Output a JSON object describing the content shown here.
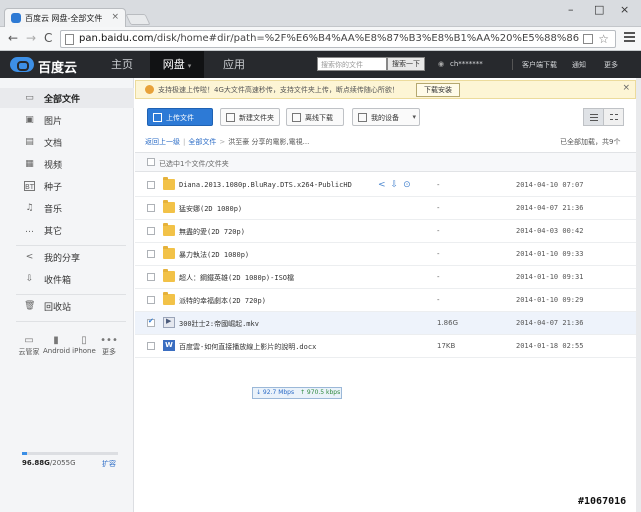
{
  "browser": {
    "tab_title": "百度云 网盘-全部文件",
    "tab_close": "×",
    "url_host": "pan.baidu.com",
    "url_path": "/disk/home#dir/path=%2F%E6%B4%AA%E8%87%B3%E8%B1%AA%20%E5%88%86%E4%BA%AB",
    "win_min": "–",
    "win_max": "□",
    "win_close": "×",
    "back": "←",
    "forward": "→",
    "reload": "C",
    "star": "☆"
  },
  "header": {
    "logo_text": "百度云",
    "nav": [
      {
        "label": "主页"
      },
      {
        "label": "网盘"
      },
      {
        "label": "应用"
      }
    ],
    "search_placeholder": "搜索你的文件",
    "search_button": "搜索一下",
    "user": "ch*******",
    "links": [
      "客户端下载",
      "通知",
      "更多"
    ]
  },
  "sidebar": {
    "items": [
      {
        "label": "全部文件",
        "icon": "▭"
      },
      {
        "label": "图片",
        "icon": "▣"
      },
      {
        "label": "文档",
        "icon": "▤"
      },
      {
        "label": "视频",
        "icon": "▦"
      },
      {
        "label": "种子",
        "icon": "BT"
      },
      {
        "label": "音乐",
        "icon": "♫"
      },
      {
        "label": "其它",
        "icon": "…"
      },
      {
        "label": "我的分享",
        "icon": "<"
      },
      {
        "label": "收件箱",
        "icon": "⇩"
      },
      {
        "label": "回收站",
        "icon": "🗑"
      }
    ],
    "devices": [
      {
        "label": "云管家",
        "icon": "▭"
      },
      {
        "label": "Android",
        "icon": "▮"
      },
      {
        "label": "iPhone",
        "icon": "▯"
      },
      {
        "label": "更多",
        "icon": "•••"
      }
    ],
    "quota_used": "96.88G",
    "quota_total": "/2055G",
    "quota_fraction": 0.047,
    "expand_label": "扩容"
  },
  "notice": {
    "text": "支持极速上传啦！4G大文件高速秒传，支持文件夹上传，断点续传随心所欲！",
    "button": "下载安装",
    "close": "×"
  },
  "toolbar": {
    "upload": "上传文件",
    "new_folder": "新建文件夹",
    "offline": "离线下载",
    "devices": "我的设备"
  },
  "breadcrumb": {
    "back": "返回上一级",
    "all": "全部文件",
    "current": "洪至豪 分享的電影,電視...",
    "loaded": "已全部加载，共9个"
  },
  "list": {
    "header": "已选中1个文件/文件夹",
    "rows": [
      {
        "name": "Diana.2013.1080p.BluRay.DTS.x264-PublicHD",
        "size": "-",
        "date": "2014-04-10 07:07",
        "type": "folder",
        "actions": true
      },
      {
        "name": "猛安娜(2D 1080p)",
        "size": "-",
        "date": "2014-04-07 21:36",
        "type": "folder"
      },
      {
        "name": "無盡的愛(2D 720p)",
        "size": "-",
        "date": "2014-04-03 00:42",
        "type": "folder"
      },
      {
        "name": "暴力執法(2D 1080p)",
        "size": "-",
        "date": "2014-01-10 09:33",
        "type": "folder"
      },
      {
        "name": "超人：鋼鐵英雄(2D 1080p)-ISO檔",
        "size": "-",
        "date": "2014-01-10 09:31",
        "type": "folder"
      },
      {
        "name": "派特的幸福劇本(2D 720p)",
        "size": "-",
        "date": "2014-01-10 09:29",
        "type": "folder"
      },
      {
        "name": "300壯士2:帝國崛起.mkv",
        "size": "1.86G",
        "date": "2014-04-07 21:36",
        "type": "video",
        "selected": true
      },
      {
        "name": "百度雲-如何直接播放線上影片的說明.docx",
        "size": "17KB",
        "date": "2014-01-18 02:55",
        "type": "word"
      }
    ]
  },
  "speed": {
    "down": "↓ 92.7 Mbps",
    "up": "↑ 970.5 kbps"
  },
  "ref_id": "#1067016"
}
